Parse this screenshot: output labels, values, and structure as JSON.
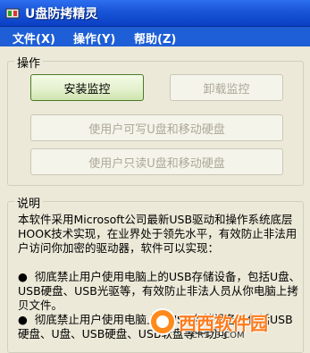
{
  "window": {
    "title": "U盘防拷精灵"
  },
  "menu": [
    {
      "label": "文件(X)"
    },
    {
      "label": "操作(Y)"
    },
    {
      "label": "帮助(Z)"
    }
  ],
  "ops": {
    "label": "操作",
    "install": "安装监控",
    "uninstall": "卸载监控",
    "allow_write": "使用户可写U盘和移动硬盘",
    "read_only": "使用户只读U盘和移动硬盘"
  },
  "desc": {
    "label": "说明",
    "text": "本软件采用Microsoft公司最新USB驱动和操作系统底层HOOK技术实现，在业界处于领先水平，有效防止非法用户访问你加密的驱动器，软件可以实现：\n\n●  彻底禁止用户使用电脑上的USB存储设备，包括U盘、USB硬盘、USB光驱等，有效防止非法人员从你电脑上拷贝文件。\n●  彻底禁止用户使用电脑上的USB存储设备，包括USB硬盘、U盘、USB硬盘、USB软盘等一切可"
  },
  "watermark": {
    "brand": "西西软件园",
    "sub": "CR173.COM"
  }
}
